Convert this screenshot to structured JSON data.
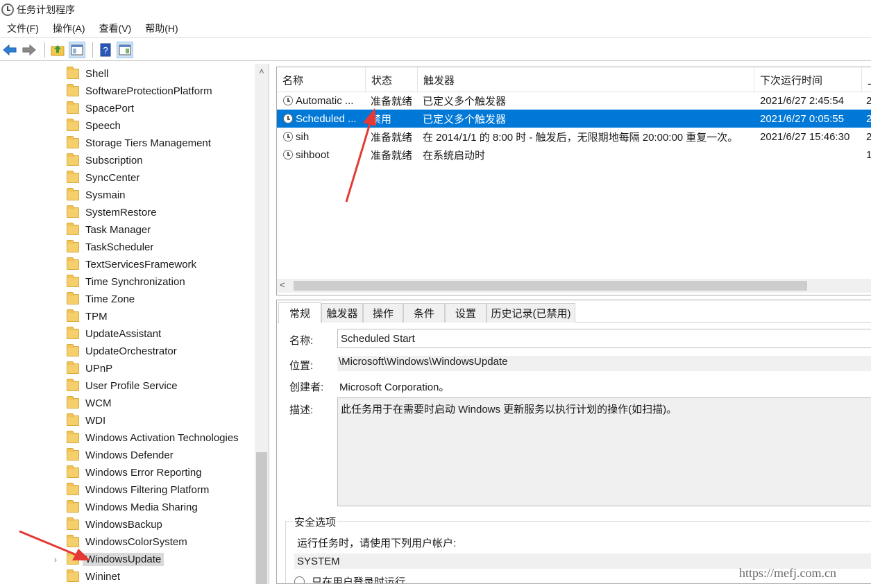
{
  "window": {
    "title": "任务计划程序"
  },
  "menu": [
    "文件(F)",
    "操作(A)",
    "查看(V)",
    "帮助(H)"
  ],
  "toolbar": {
    "icons": [
      "back-arrow-icon",
      "forward-arrow-icon",
      "folder-up-icon",
      "show-hide-console-tree-icon",
      "help-icon",
      "show-hide-action-pane-icon"
    ]
  },
  "tree": {
    "items": [
      "Shell",
      "SoftwareProtectionPlatform",
      "SpacePort",
      "Speech",
      "Storage Tiers Management",
      "Subscription",
      "SyncCenter",
      "Sysmain",
      "SystemRestore",
      "Task Manager",
      "TaskScheduler",
      "TextServicesFramework",
      "Time Synchronization",
      "Time Zone",
      "TPM",
      "UpdateAssistant",
      "UpdateOrchestrator",
      "UPnP",
      "User Profile Service",
      "WCM",
      "WDI",
      "Windows Activation Technologies",
      "Windows Defender",
      "Windows Error Reporting",
      "Windows Filtering Platform",
      "Windows Media Sharing",
      "WindowsBackup",
      "WindowsColorSystem",
      "WindowsUpdate",
      "Wininet"
    ],
    "selected": "WindowsUpdate"
  },
  "tasklist": {
    "columns": [
      "名称",
      "状态",
      "触发器",
      "下次运行时间",
      "上"
    ],
    "rows": [
      {
        "name": "Automatic ...",
        "status": "准备就绪",
        "trigger": "已定义多个触发器",
        "next_run": "2021/6/27 2:45:54",
        "extra": "2"
      },
      {
        "name": "Scheduled ...",
        "status": "禁用",
        "trigger": "已定义多个触发器",
        "next_run": "2021/6/27 0:05:55",
        "extra": "2"
      },
      {
        "name": "sih",
        "status": "准备就绪",
        "trigger": "在 2014/1/1 的 8:00 时 - 触发后，无限期地每隔 20:00:00 重复一次。",
        "next_run": "2021/6/27 15:46:30",
        "extra": "2"
      },
      {
        "name": "sihboot",
        "status": "准备就绪",
        "trigger": "在系统启动时",
        "next_run": "",
        "extra": "1"
      }
    ],
    "selected_index": 1
  },
  "details": {
    "tabs": [
      "常规",
      "触发器",
      "操作",
      "条件",
      "设置",
      "历史记录(已禁用)"
    ],
    "active_tab": "常规",
    "name_label": "名称:",
    "name_value": "Scheduled Start",
    "location_label": "位置:",
    "location_value": "\\Microsoft\\Windows\\WindowsUpdate",
    "author_label": "创建者:",
    "author_value": "Microsoft Corporation。",
    "desc_label": "描述:",
    "desc_value": "此任务用于在需要时启动 Windows 更新服务以执行计划的操作(如扫描)。",
    "security": {
      "title": "安全选项",
      "run_as_label": "运行任务时，请使用下列用户帐户:",
      "account": "SYSTEM",
      "option_logged_on": "只在用户登录时运行"
    }
  },
  "watermark": "https://mefj.com.cn",
  "colors": {
    "selection": "#0078d7",
    "annotation_arrow": "#e53935",
    "folder": "#f5cf6b"
  }
}
